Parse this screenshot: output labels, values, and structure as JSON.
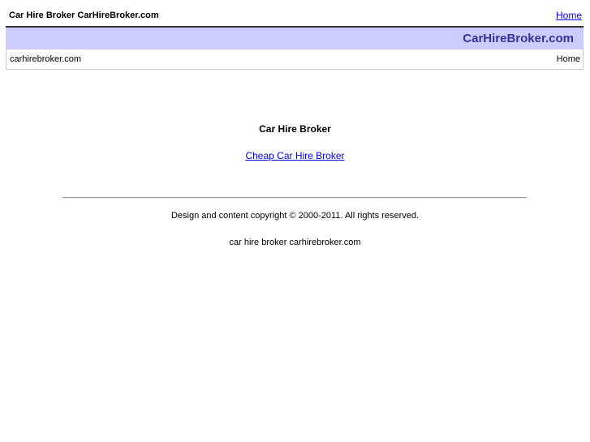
{
  "header": {
    "site_title": "Car Hire Broker CarHireBroker.com",
    "home_link": "Home"
  },
  "banner": {
    "title": "CarHireBroker.com",
    "background_color": "#ccccff",
    "title_color": "#333399"
  },
  "breadcrumb": {
    "site": "carhirebroker.com",
    "current": "Home"
  },
  "main": {
    "heading": "Car Hire Broker",
    "link_label": "Cheap Car Hire Broker"
  },
  "footer": {
    "copyright": "Design and content copyright © 2000-2011. All rights reserved.",
    "tagline": "car hire broker carhirebroker.com"
  }
}
